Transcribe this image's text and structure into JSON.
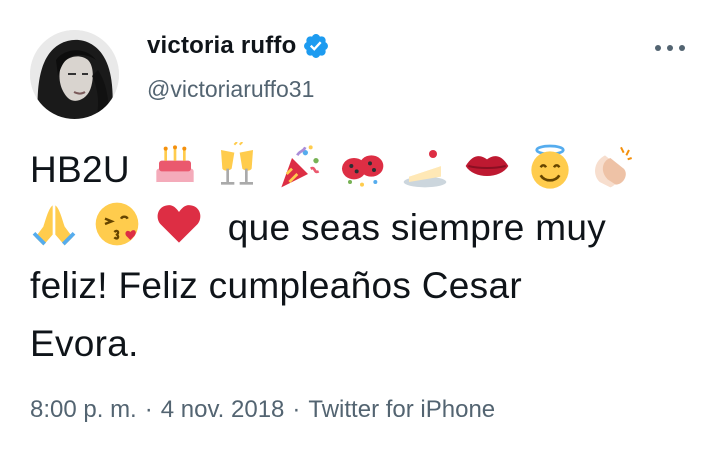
{
  "user": {
    "display_name": "victoria ruffo",
    "handle": "@victoriaruffo31",
    "verified": true
  },
  "icons": {
    "more": "more-horizontal-icon",
    "verified": "verified-badge-icon"
  },
  "tweet": {
    "lead": "HB2U",
    "emoji_row1": [
      "birthday-cake-icon",
      "clinking-glasses-icon",
      "party-popper-icon",
      "ladybugs-confetti-icon",
      "cake-slice-icon",
      "lips-kiss-icon",
      "smiling-halo-face-icon",
      "clapping-hands-icon"
    ],
    "emoji_row2": [
      "praying-hands-icon",
      "face-blowing-kiss-icon",
      "red-heart-icon"
    ],
    "message_line1": "que seas siempre muy",
    "message_line2": "feliz! Feliz cumpleaños Cesar",
    "message_line3": "Evora."
  },
  "meta": {
    "time": "8:00 p. m.",
    "separator": "·",
    "date": "4 nov. 2018",
    "source": "Twitter for iPhone"
  },
  "colors": {
    "text": "#0f1419",
    "secondary": "#536471",
    "verified": "#1d9bf0"
  }
}
